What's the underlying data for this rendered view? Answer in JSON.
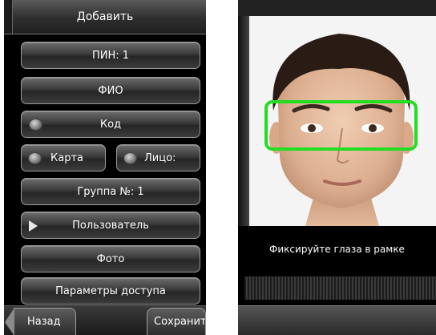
{
  "left": {
    "header": {
      "title": "Добавить"
    },
    "buttons": {
      "pin": "ПИН: 1",
      "name": "ФИО",
      "password": "Код",
      "card": "Карта",
      "face": "Лицо:",
      "group": "Группа №: 1",
      "user": "Пользователь",
      "photo": "Фото",
      "access": "Параметры доступа"
    },
    "footer": {
      "back": "Назад",
      "save": "Сохранить"
    }
  },
  "right": {
    "instruction": "Фиксируйте глаза в рамке",
    "eye_frame_color": "#22dd22"
  }
}
